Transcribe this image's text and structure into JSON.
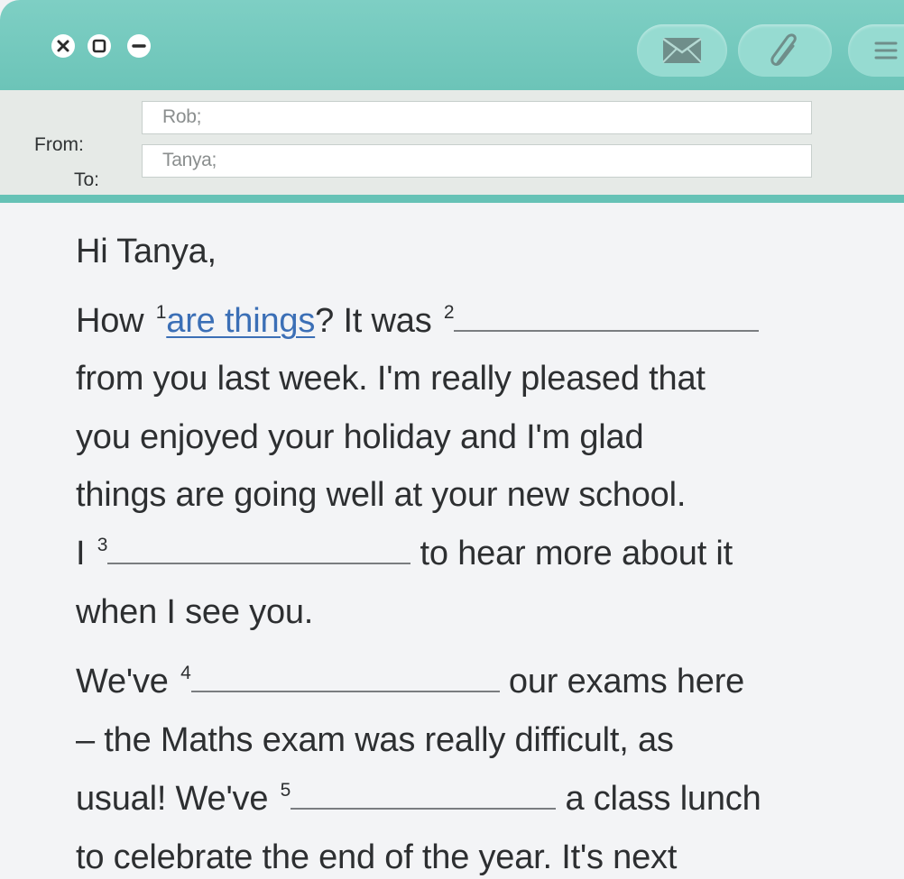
{
  "window_controls": {
    "close_icon": "close-icon",
    "maximize_icon": "maximize-icon",
    "minimize_icon": "minimize-icon"
  },
  "toolbar": {
    "mail_icon": "mail-icon",
    "attach_icon": "paperclip-icon",
    "menu_icon": "menu-icon"
  },
  "header": {
    "from_label": "From:",
    "from_value": "Rob;",
    "to_label": "To:",
    "to_value": "Tanya;"
  },
  "email_body": {
    "greeting": "Hi Tanya,",
    "line1": {
      "before": "How ",
      "num1": "1",
      "answer": "are things",
      "mid": "? It was ",
      "num2": "2"
    },
    "line2": "from you last week. I'm really pleased that",
    "line3": "you enjoyed your holiday and I'm glad",
    "line4": "things are going well at your new school.",
    "line5": {
      "before": "I ",
      "num": "3",
      "after": " to hear more about it"
    },
    "line6": "when I see you.",
    "line7": {
      "before": "We've ",
      "num": "4",
      "after": " our exams here"
    },
    "line8": "– the Maths exam was really difficult, as",
    "line9": {
      "before": "usual! We've ",
      "num": "5",
      "after": " a class lunch"
    },
    "line10": "to celebrate the end of the year. It's next"
  },
  "colors": {
    "titlebar": "#6cc4b8",
    "toolbar_button": "#96dbd1",
    "header_bg": "#e6eae7",
    "divider": "#66c2b6",
    "answer_text": "#3b6fb6"
  }
}
